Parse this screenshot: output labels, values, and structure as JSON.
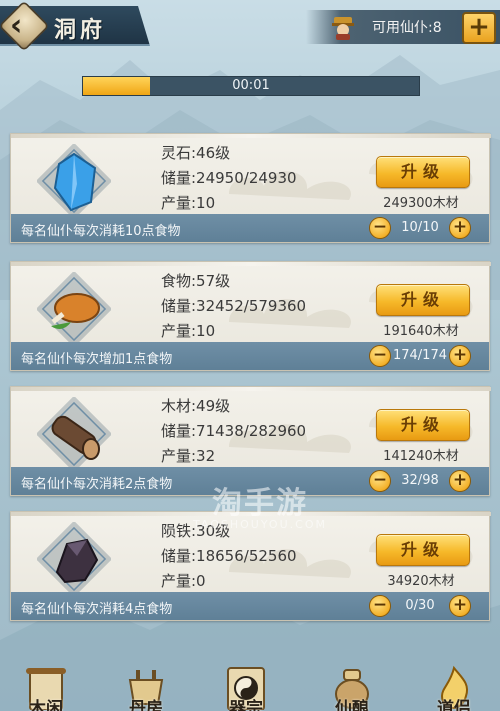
{
  "header": {
    "title": "洞府",
    "worker_label": "可用仙仆:8",
    "back_icon": "chevron-left-icon",
    "worker_icon": "servant-avatar-icon",
    "add_icon": "plus-icon"
  },
  "timer": {
    "text": "00:01",
    "progress": 0.2
  },
  "buildings": [
    {
      "name": "灵石:46级",
      "storage": "储量:24950/24930",
      "production": "产量:10",
      "upgrade_label": "升级",
      "cost": "249300木材",
      "note": "每名仙仆每次消耗10点食物",
      "workers": "10/10",
      "icon": "spirit-stone-icon",
      "icon_color": "#3aa0e8"
    },
    {
      "name": "食物:57级",
      "storage": "储量:32452/579360",
      "production": "产量:10",
      "upgrade_label": "升级",
      "cost": "191640木材",
      "note": "每名仙仆每次增加1点食物",
      "workers": "174/174",
      "icon": "roast-meat-icon",
      "icon_color": "#d9822b"
    },
    {
      "name": "木材:49级",
      "storage": "储量:71438/282960",
      "production": "产量:32",
      "upgrade_label": "升级",
      "cost": "141240木材",
      "note": "每名仙仆每次消耗2点食物",
      "workers": "32/98",
      "icon": "wood-log-icon",
      "icon_color": "#6b4a33"
    },
    {
      "name": "陨铁:30级",
      "storage": "储量:18656/52560",
      "production": "产量:0",
      "upgrade_label": "升级",
      "cost": "34920木材",
      "note": "每名仙仆每次消耗4点食物",
      "workers": "0/30",
      "icon": "meteoric-iron-icon",
      "icon_color": "#3d3140"
    }
  ],
  "nav": [
    {
      "label": "木闲",
      "icon": "scroll-icon"
    },
    {
      "label": "丹房",
      "icon": "cauldron-icon"
    },
    {
      "label": "器宗",
      "icon": "yin-yang-icon"
    },
    {
      "label": "仙酿",
      "icon": "wine-jar-icon"
    },
    {
      "label": "道侣",
      "icon": "flame-icon"
    }
  ],
  "watermark": {
    "main": "淘手游",
    "sub": "TAOSHOUYOU.COM"
  },
  "colors": {
    "accent": "#f0a615",
    "panel": "#3a5264",
    "footer": "#6f8fa6"
  }
}
